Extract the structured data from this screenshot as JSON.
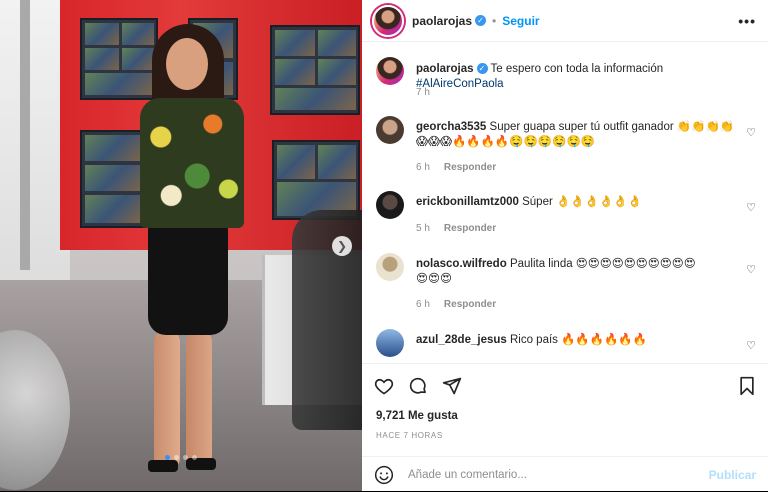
{
  "post": {
    "author": "paolarojas",
    "verified": true,
    "follow_label": "Seguir",
    "more_icon": "more-horizontal-icon",
    "caption": "Te espero con toda la información",
    "hashtag": "#AlAireConPaola",
    "caption_time": "7 h",
    "carousel": {
      "slides": 4,
      "active_index": 0
    }
  },
  "comments": [
    {
      "user": "georcha3535",
      "text": "Super guapa super tú outfit ganador 👏👏👏👏",
      "emoji_line": "😱😱😱🔥🔥🔥🔥🤤🤤🤤🤤🤤🤤",
      "time": "6 h",
      "reply_label": "Responder"
    },
    {
      "user": "erickbonillamtz000",
      "text": "Súper 👌👌👌👌👌👌",
      "time": "5 h",
      "reply_label": "Responder"
    },
    {
      "user": "nolasco.wilfredo",
      "text": "Paulita linda 😍😍😍😍😍😍😍😍😍😍",
      "emoji_line": "😍😍😍",
      "time": "6 h",
      "reply_label": "Responder"
    },
    {
      "user": "azul_28de_jesus",
      "text": "Rico país 🔥🔥🔥🔥🔥🔥",
      "time": "",
      "reply_label": ""
    }
  ],
  "actions": {
    "like_icon": "heart-outline-icon",
    "comment_icon": "comment-bubble-icon",
    "share_icon": "send-paper-plane-icon",
    "save_icon": "bookmark-icon",
    "likes_text": "9,721 Me gusta",
    "time_ago": "HACE 7 HORAS"
  },
  "composer": {
    "emoji_icon": "smiley-icon",
    "placeholder": "Añade un comentario...",
    "publish_label": "Publicar"
  },
  "colors": {
    "link_blue": "#0095f6",
    "hashtag_blue": "#00376b",
    "publish_disabled": "#b2dffc"
  }
}
